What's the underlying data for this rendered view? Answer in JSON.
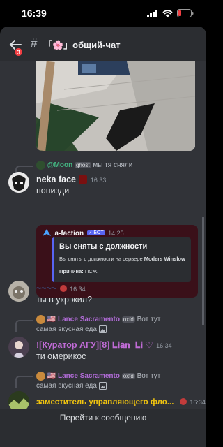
{
  "status": {
    "time": "16:39"
  },
  "header": {
    "badge": "3",
    "hash": "#",
    "channel_name": "「🌸」общий-чат"
  },
  "messages": [
    {
      "reply": {
        "name": "@Moon",
        "tag": "ghost",
        "text": "мы тя сняли"
      },
      "author": "neka face",
      "time": "16:33",
      "text": "попизди"
    },
    {
      "embed": {
        "bot_name": "a-faction",
        "bot_tag": "✓ БОТ",
        "time": "14:25",
        "title": "Вы сняты с должности",
        "desc_prefix": "Вы сняты с должности на сервере",
        "desc_server": "Moders Winslow",
        "reason_label": "Причина:",
        "reason_value": "ПСЖ"
      }
    },
    {
      "author": "~~~~",
      "time": "16:34",
      "text": "ты в укр жил?"
    },
    {
      "reply": {
        "name": "Lance Sacramento",
        "tag": "oxfd",
        "text_right": "Вот тут",
        "text": "самая вкусная еда"
      },
      "author": "![Куратор АГУ][8] 𝐋𝐢𝐚𝐧_𝐋𝐢 ♡",
      "time": "16:34",
      "text": "ти омерикос"
    },
    {
      "reply": {
        "name": "Lance Sacramento",
        "tag": "oxfd",
        "text_right": "Вот тут",
        "text": "самая вкусная еда"
      },
      "author": "заместитель управляющего фло...",
      "time": "16:34"
    }
  ],
  "jump_label": "Перейти к сообщению",
  "colors": {
    "bg": "#313338",
    "accent": "#5865f2",
    "embed_bg": "#3a1019"
  }
}
